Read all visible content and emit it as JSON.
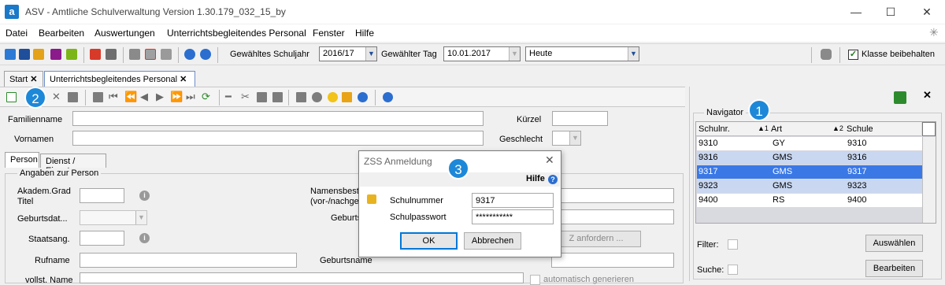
{
  "window": {
    "title": "ASV - Amtliche Schulverwaltung Version 1.30.179_032_15_by",
    "logo_letter": "a",
    "minimize": "—",
    "maximize": "☐",
    "close": "✕"
  },
  "menu": {
    "items": [
      {
        "label": "Datei"
      },
      {
        "label": "Bearbeiten"
      },
      {
        "label": "Auswertungen"
      },
      {
        "label": "Unterrichtsbegleitendes Personal"
      },
      {
        "label": "Fenster"
      },
      {
        "label": "Hilfe"
      }
    ]
  },
  "toolbar": {
    "schuljahr_label": "Gewähltes Schuljahr",
    "schuljahr_value": "2016/17",
    "tag_label": "Gewählter Tag",
    "tag_value": "10.01.2017",
    "heute_value": "Heute",
    "klasse_label": "Klasse beibehalten",
    "klasse_checked": true
  },
  "tabs": [
    {
      "label": "Start",
      "close": "✕"
    },
    {
      "label": "Unterrichtsbegleitendes Personal",
      "close": "✕"
    }
  ],
  "form": {
    "familienname_label": "Familienname",
    "vornamen_label": "Vornamen",
    "kuerzel_label": "Kürzel",
    "geschlecht_label": "Geschlecht",
    "subtabs": [
      "Person",
      "Dienst / Einsatz"
    ],
    "group_title": "Angaben zur Person",
    "akadem_label_1": "Akadem.Grad",
    "akadem_label_2": "Titel",
    "geburtsdat_label": "Geburtsdat...",
    "staatsang_label": "Staatsang.",
    "rufname_label": "Rufname",
    "vollst_label": "vollst. Name",
    "namensbest_label_1": "Namensbest",
    "namensbest_label_2": "(vor-/nachge",
    "geburts_label": "Geburts",
    "geburtsname_label": "Geburtsname",
    "anfordern_label": "Z anfordern ...",
    "auto_label": "automatisch generieren"
  },
  "navigator": {
    "title": "Navigator",
    "columns": [
      "Schulnr.",
      "Art",
      "Schule"
    ],
    "sort_marks": [
      "▲1",
      "▲2"
    ],
    "rows": [
      {
        "schulnr": "9310",
        "art": "GY",
        "schule": "9310",
        "selected": false
      },
      {
        "schulnr": "9316",
        "art": "GMS",
        "schule": "9316",
        "selected": false
      },
      {
        "schulnr": "9317",
        "art": "GMS",
        "schule": "9317",
        "selected": true
      },
      {
        "schulnr": "9323",
        "art": "GMS",
        "schule": "9323",
        "selected": false
      },
      {
        "schulnr": "9400",
        "art": "RS",
        "schule": "9400",
        "selected": false
      }
    ],
    "filter_label": "Filter:",
    "suche_label": "Suche:",
    "auswaehlen_label": "Auswählen",
    "bearbeiten_label": "Bearbeiten"
  },
  "dialog": {
    "title": "ZSS Anmeldung",
    "help_label": "Hilfe",
    "schulnummer_label": "Schulnummer",
    "schulnummer_value": "9317",
    "passwort_label": "Schulpasswort",
    "passwort_value": "***********",
    "ok_label": "OK",
    "abbrechen_label": "Abbrechen"
  },
  "badges": [
    "1",
    "2",
    "3"
  ],
  "colors": {
    "accent": "#1e88d8",
    "selection": "#3a78e6",
    "row_alt": "#c9d7f0"
  }
}
